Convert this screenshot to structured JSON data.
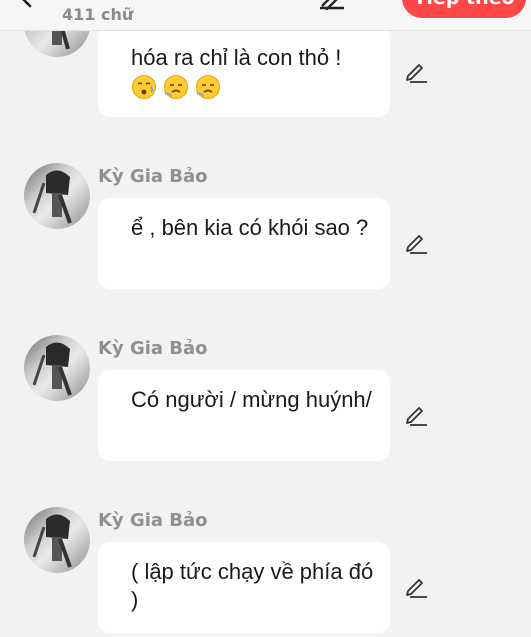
{
  "header": {
    "word_count": "411 chữ",
    "next_label": "Tiếp theo"
  },
  "messages": [
    {
      "author": "",
      "text": "hóa ra chỉ là con thỏ !",
      "emojis": [
        "sad-face-emoji",
        "sigh-face-emoji",
        "sigh-face-emoji"
      ]
    },
    {
      "author": "Kỳ Gia Bảo",
      "text": "ể , bên kia có khói sao ?"
    },
    {
      "author": "Kỳ Gia Bảo",
      "text": "Có người / mừng huýnh/"
    },
    {
      "author": "Kỳ Gia Bảo",
      "text": "( lập tức chạy về phía đó )"
    }
  ],
  "colors": {
    "accent": "#ff4747",
    "background": "#f2f2f2",
    "bubble": "#ffffff",
    "author": "#8f8f8f"
  }
}
